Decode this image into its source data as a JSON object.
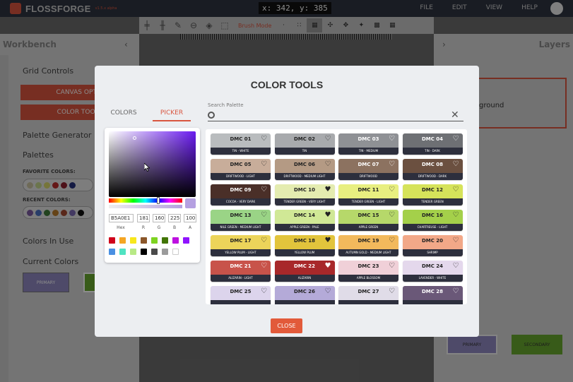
{
  "app": {
    "name": "FLOSSFORGE",
    "version": "v1.5.x alpha"
  },
  "coords": "x: 342, y: 385",
  "menu": [
    "FILE",
    "EDIT",
    "VIEW",
    "HELP"
  ],
  "toolbar": {
    "brush_label": "Brush Mode"
  },
  "left_panel": {
    "title": "Workbench",
    "grid_controls": "Grid Controls",
    "canvas_options": "CANVAS OPTIO",
    "color_tools": "COLOR TOOLS",
    "palette_generator": "Palette Generator",
    "palettes": "Palettes",
    "favorite_colors": "FAVORITE COLORS:",
    "recent_colors": "RECENT COLORS:",
    "colors_in_use": "Colors In Use",
    "current_colors": "Current Colors",
    "primary": "PRIMARY",
    "favorites": [
      "#c9c2a0",
      "#c4d68c",
      "#d8d66a",
      "#b82a2a",
      "#8c1f2c",
      "#25307a"
    ],
    "recents": [
      "#7a5a9e",
      "#4a6fbf",
      "#3e7a3a",
      "#b87a2a",
      "#a34830",
      "#7a69b3",
      "#111111"
    ]
  },
  "right_panel": {
    "title": "Layers",
    "layers_label": "Layers",
    "layer_name": "ground",
    "primary": "PRIMARY",
    "secondary": "SECONDARY"
  },
  "modal": {
    "title": "COLOR TOOLS",
    "tabs": [
      "COLORS",
      "PICKER"
    ],
    "picker": {
      "hex": "B5A0E1",
      "r": "181",
      "g": "160",
      "b": "225",
      "a": "100",
      "labels": [
        "Hex",
        "R",
        "G",
        "B",
        "A"
      ],
      "presets": [
        "#d0021b",
        "#f5a623",
        "#f8e71c",
        "#8b572a",
        "#7ed321",
        "#417505",
        "#bd10e0",
        "#9013fe",
        "#4a90e2",
        "#50e3c2",
        "#b8e986",
        "#000000",
        "#4a4a4a",
        "#9b9b9b",
        "#ffffff"
      ]
    },
    "search_label": "Search Palette",
    "close": "CLOSE",
    "threads": [
      {
        "id": "DMC 01",
        "desc": "TIN - WHITE",
        "color": "#b9bcbe",
        "fav": false,
        "dark": false
      },
      {
        "id": "DMC 02",
        "desc": "TIN",
        "color": "#a8aaad",
        "fav": false,
        "dark": false
      },
      {
        "id": "DMC 03",
        "desc": "TIN - MEDIUM",
        "color": "#8f9195",
        "fav": false,
        "dark": true
      },
      {
        "id": "DMC 04",
        "desc": "TIN - DARK",
        "color": "#6e7074",
        "fav": false,
        "dark": true
      },
      {
        "id": "DMC 05",
        "desc": "DRIFTWOOD - LIGHT",
        "color": "#c8ad9a",
        "fav": false,
        "dark": false
      },
      {
        "id": "DMC 06",
        "desc": "DRIFTWOOD - MEDIUM LIGHT",
        "color": "#b49a84",
        "fav": false,
        "dark": false
      },
      {
        "id": "DMC 07",
        "desc": "DRIFTWOOD",
        "color": "#8c7260",
        "fav": false,
        "dark": true
      },
      {
        "id": "DMC 08",
        "desc": "DRIFTWOOD - DARK",
        "color": "#6b5040",
        "fav": false,
        "dark": true
      },
      {
        "id": "DMC 09",
        "desc": "COCOA - VERY DARK",
        "color": "#4a2f28",
        "fav": false,
        "dark": true
      },
      {
        "id": "DMC 10",
        "desc": "TENDER GREEN - VERY LIGHT",
        "color": "#e4ecb0",
        "fav": true,
        "dark": false
      },
      {
        "id": "DMC 11",
        "desc": "TENDER GREEN - LIGHT",
        "color": "#e8ef80",
        "fav": false,
        "dark": false
      },
      {
        "id": "DMC 12",
        "desc": "TENDER GREEN",
        "color": "#d6e35a",
        "fav": false,
        "dark": false
      },
      {
        "id": "DMC 13",
        "desc": "NILE GREEN - MEDIUM LIGHT",
        "color": "#9ad486",
        "fav": false,
        "dark": false
      },
      {
        "id": "DMC 14",
        "desc": "APPLE GREEN - PALE",
        "color": "#d0e896",
        "fav": true,
        "dark": false
      },
      {
        "id": "DMC 15",
        "desc": "APPLE GREEN",
        "color": "#b6d86a",
        "fav": false,
        "dark": false
      },
      {
        "id": "DMC 16",
        "desc": "CHARTREUSE - LIGHT",
        "color": "#a4d04a",
        "fav": false,
        "dark": false
      },
      {
        "id": "DMC 17",
        "desc": "YELLOW PLUM - LIGHT",
        "color": "#ecd45a",
        "fav": false,
        "dark": false
      },
      {
        "id": "DMC 18",
        "desc": "YELLOW PLUM",
        "color": "#e2c43c",
        "fav": true,
        "dark": false
      },
      {
        "id": "DMC 19",
        "desc": "AUTUMN GOLD - MEDIUM LIGHT",
        "color": "#f2b95c",
        "fav": false,
        "dark": false
      },
      {
        "id": "DMC 20",
        "desc": "SHRIMP",
        "color": "#f2a888",
        "fav": false,
        "dark": false
      },
      {
        "id": "DMC 21",
        "desc": "ALIZARIN - LIGHT",
        "color": "#c8534a",
        "fav": false,
        "dark": true
      },
      {
        "id": "DMC 22",
        "desc": "ALIZARIN",
        "color": "#a8282a",
        "fav": true,
        "dark": true
      },
      {
        "id": "DMC 23",
        "desc": "APPLE BLOSSOM",
        "color": "#f0d0d8",
        "fav": false,
        "dark": false
      },
      {
        "id": "DMC 24",
        "desc": "LAVENDER - WHITE",
        "color": "#e4d8ec",
        "fav": false,
        "dark": false
      },
      {
        "id": "DMC 25",
        "desc": "",
        "color": "#dcd4ec",
        "fav": false,
        "dark": false
      },
      {
        "id": "DMC 26",
        "desc": "",
        "color": "#b4aad8",
        "fav": false,
        "dark": false
      },
      {
        "id": "DMC 27",
        "desc": "",
        "color": "#e0dce8",
        "fav": false,
        "dark": false
      },
      {
        "id": "DMC 28",
        "desc": "",
        "color": "#6a5878",
        "fav": false,
        "dark": true
      }
    ]
  }
}
